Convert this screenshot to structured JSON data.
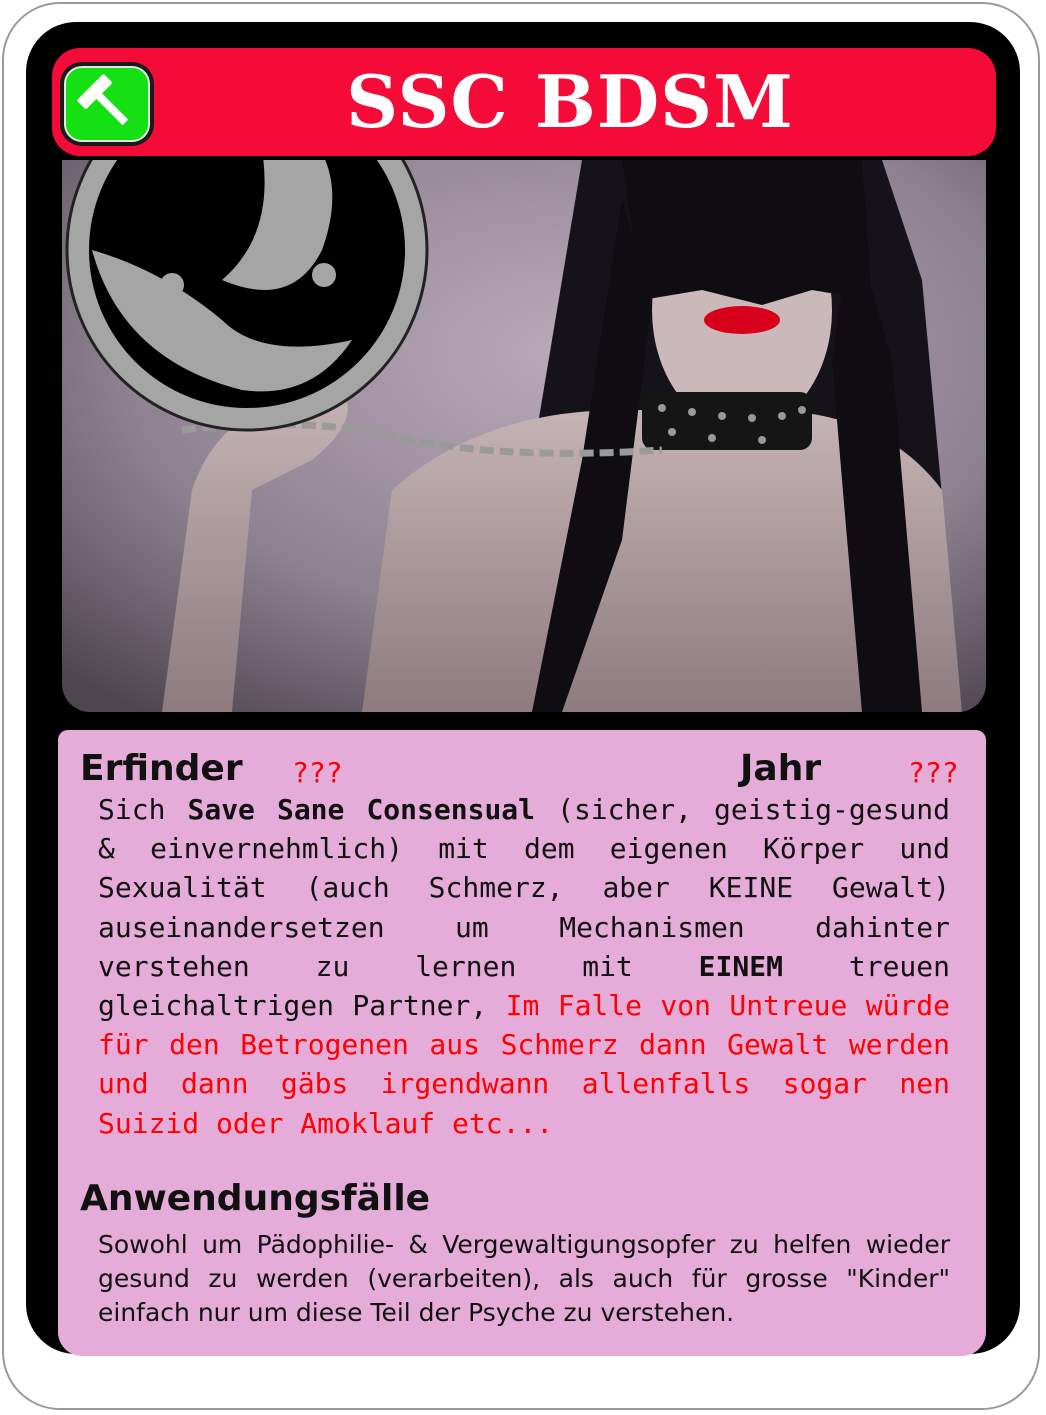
{
  "card": {
    "title": "SSC BDSM",
    "icon": "hammer-icon",
    "colors": {
      "title_bar": "#f40b37",
      "icon_badge": "#14e014",
      "panel": "#e6acd9",
      "highlight": "#ff0000"
    }
  },
  "stats": {
    "inventor_label": "Erfinder",
    "inventor_value": "???",
    "year_label": "Jahr",
    "year_value": "???"
  },
  "description": {
    "part1": "Sich ",
    "bold1": "Save Sane Consensual",
    "part2": " (sicher, geistig-gesund & einvernehmlich) mit dem eigenen Körper und Sexualität (auch Schmerz, aber KEINE Gewalt) auseinandersetzen um Mechanismen dahinter verstehen zu lernen mit ",
    "bold2": "EINEM",
    "part3": " treuen gleichaltrigen Partner, ",
    "red": "Im Falle von Untreue würde für den Betrogenen aus Schmerz dann Gewalt werden und dann gäbs irgendwann allenfalls sogar nen Suizid oder Amoklauf etc..."
  },
  "use_cases": {
    "heading": "Anwendungsfälle",
    "text": "Sowohl um Pädophilie- & Vergewaltigungsopfer zu helfen wieder gesund zu werden (verarbeiten), als auch für grosse \"Kinder\" einfach nur um diese Teil der Psyche zu verstehen."
  }
}
